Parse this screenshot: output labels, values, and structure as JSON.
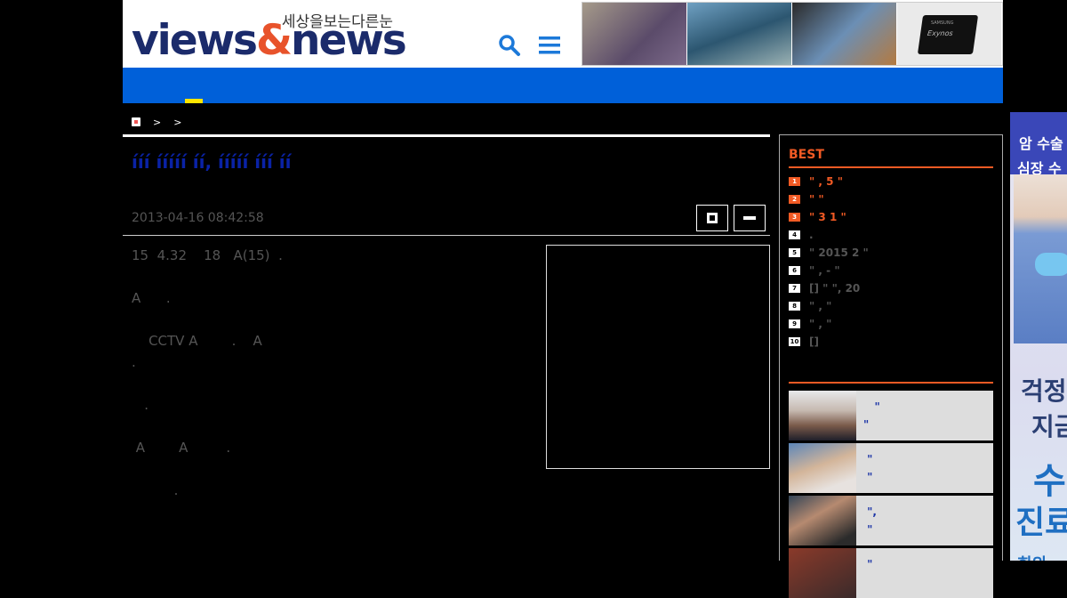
{
  "header": {
    "logo_tagline": "세상을보는다른눈",
    "logo_part1": "views",
    "logo_amp": "&",
    "logo_part2": "news",
    "banner_chip_brand": "SAMSUNG",
    "banner_chip_label": "Exynos",
    "brand_colors": {
      "navy": "#1b2b6b",
      "orange": "#e8532b",
      "blue": "#0060d9"
    }
  },
  "breadcrumb": {
    "sep1": ">",
    "sep2": ">"
  },
  "article": {
    "title": "ííí ííííí íí, ííííí ííí íí",
    "date": "2013-04-16 08:42:58",
    "paragraphs": [
      "15  4.32    18   A(15)  .",
      "A      .",
      "    CCTV A        .    A",
      ".",
      "   .",
      " A        A         .",
      "          ."
    ]
  },
  "sidebar": {
    "best_title": "BEST",
    "ranks": [
      {
        "num": "1",
        "text": "\" ,   5 \"",
        "hot": true
      },
      {
        "num": "2",
        "text": "\"    \"",
        "hot": true
      },
      {
        "num": "3",
        "text": "\" 3 1   \"",
        "hot": true
      },
      {
        "num": "4",
        "text": "  .",
        "hot": false
      },
      {
        "num": "5",
        "text": "\" 2015   2 \"",
        "hot": false
      },
      {
        "num": "6",
        "text": "\" , -   \"",
        "hot": false
      },
      {
        "num": "7",
        "text": "[]   \" \", 20",
        "hot": false
      },
      {
        "num": "8",
        "text": " \"  ,    \"",
        "hot": false
      },
      {
        "num": "9",
        "text": " \" ,       \"",
        "hot": false
      },
      {
        "num": "10",
        "text": "[]",
        "hot": false
      }
    ],
    "news": [
      {
        "text": "   \"\n\""
      },
      {
        "text": " \"\n \""
      },
      {
        "text": " \",\n \""
      },
      {
        "text": " \""
      }
    ]
  },
  "ad": {
    "line1": "암 수술",
    "line2": "심장 수",
    "line3": "걱정",
    "line4": "지금",
    "line5": "수",
    "line6": "진료",
    "line7": "회의"
  }
}
